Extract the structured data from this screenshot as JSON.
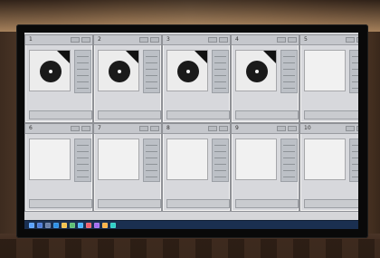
{
  "colors": {
    "screen_bg": "#d5d6d9",
    "taskbar_bg": "#1a2f50",
    "target_black": "#111111"
  },
  "panes": [
    {
      "label": "1",
      "content": "target"
    },
    {
      "label": "2",
      "content": "target"
    },
    {
      "label": "3",
      "content": "target"
    },
    {
      "label": "4",
      "content": "target"
    },
    {
      "label": "5",
      "content": "empty"
    },
    {
      "label": "6",
      "content": "empty"
    },
    {
      "label": "7",
      "content": "empty"
    },
    {
      "label": "8",
      "content": "empty"
    },
    {
      "label": "9",
      "content": "empty"
    },
    {
      "label": "10",
      "content": "empty"
    }
  ],
  "taskbar": {
    "icons": [
      {
        "name": "start-icon",
        "color": "#5aa2ff"
      },
      {
        "name": "search-icon",
        "color": "#4c7bd8"
      },
      {
        "name": "task-view-icon",
        "color": "#6a7fa8"
      },
      {
        "name": "edge-icon",
        "color": "#2d91e7"
      },
      {
        "name": "folder-icon",
        "color": "#f2c14d"
      },
      {
        "name": "store-icon",
        "color": "#5dbf75"
      },
      {
        "name": "mail-icon",
        "color": "#49b4ff"
      },
      {
        "name": "app-icon-1",
        "color": "#f05f6d"
      },
      {
        "name": "app-icon-2",
        "color": "#a36df2"
      },
      {
        "name": "app-icon-3",
        "color": "#ffb347"
      },
      {
        "name": "app-icon-4",
        "color": "#2fd0c7"
      }
    ]
  }
}
